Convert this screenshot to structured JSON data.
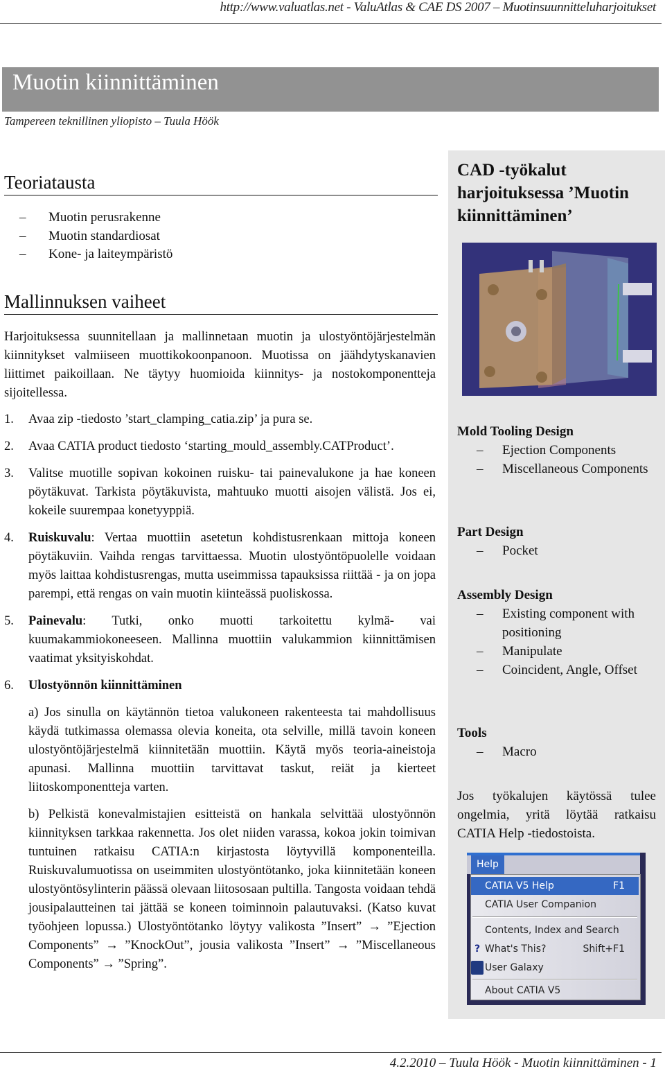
{
  "header": {
    "running_title": "http://www.valuatlas.net - ValuAtlas & CAE DS 2007 – Muotinsuunnitteluharjoitukset"
  },
  "title": {
    "main": "Muotin kiinnittäminen",
    "subtitle": "Tampereen teknillinen yliopisto – Tuula Höök"
  },
  "theory": {
    "heading": "Teoriatausta",
    "items": [
      "Muotin perusrakenne",
      "Muotin standardiosat",
      "Kone- ja laiteympäristö"
    ]
  },
  "phases": {
    "heading": "Mallinnuksen vaiheet",
    "intro": "Harjoituksessa suunnitellaan ja mallinnetaan muotin ja ulostyöntöjärjestelmän kiinnitykset valmiiseen muottikokoonpanoon. Muotissa on jäähdytyskanavien liittimet paikoillaan. Ne täytyy huomioida kiinnitys- ja nostokomponentteja sijoitellessa.",
    "steps": [
      {
        "num": "1.",
        "bold": "",
        "text": "Avaa zip -tiedosto ’start_clamping_catia.zip’ ja pura se."
      },
      {
        "num": "2.",
        "bold": "",
        "text": "Avaa CATIA product tiedosto ‘starting_mould_assembly.CATProduct’."
      },
      {
        "num": "3.",
        "bold": "",
        "text": "Valitse muotille sopivan kokoinen ruisku- tai painevalukone ja hae koneen pöytäkuvat. Tarkista pöytäkuvista, mahtuuko muotti aisojen välistä. Jos ei, kokeile suurempaa konetyyppiä."
      },
      {
        "num": "4.",
        "bold": "Ruiskuvalu",
        "text": ": Vertaa muottiin asetetun kohdistusrenkaan mittoja koneen pöytäkuviin. Vaihda rengas tarvittaessa. Muotin ulostyöntöpuolelle voidaan myös laittaa kohdistusrengas, mutta useimmissa tapauksissa riittää - ja on jopa parempi, että rengas on vain muotin kiinteässä puoliskossa."
      },
      {
        "num": "5.",
        "bold": "Painevalu",
        "text": ": Tutki, onko muotti tarkoitettu kylmä- vai kuumakammiokoneeseen. Mallinna muottiin valukammion kiinnittämisen vaatimat yksityiskohdat."
      },
      {
        "num": "6.",
        "bold": "Ulostyönnön kiinnittäminen",
        "text": "",
        "sub_a": "a) Jos sinulla on käytännön tietoa valukoneen rakenteesta tai mahdollisuus käydä tutkimassa olemassa olevia koneita, ota selville, millä tavoin koneen ulostyöntöjärjestelmä kiinnitetään muottiin. Käytä myös teoria-aineistoja apunasi. Mallinna muottiin tarvittavat taskut, reiät ja kierteet liitoskomponentteja varten.",
        "sub_b": "b) Pelkistä konevalmistajien esitteistä on hankala selvittää ulostyönnön kiinnityksen tarkkaa rakennetta. Jos olet niiden varassa, kokoa jokin toimivan tuntuinen ratkaisu CATIA:n kirjastosta löytyvillä komponenteilla. Ruiskuvalumuotissa on useimmiten ulostyöntötanko, joka kiinnitetään koneen ulostyöntösylinterin päässä olevaan liitososaan pultilla. Tangosta voidaan tehdä jousipalautteinen tai jättää se koneen toiminnoin palautuvaksi. (Katso kuvat työohjeen lopussa.) Ulostyöntötanko löytyy valikosta ”Insert” → ”Ejection Components” → ”KnockOut”, jousia valikosta ”Insert” → ”Miscellaneous Components” → ”Spring”."
      }
    ]
  },
  "sidebar": {
    "heading": "CAD -työkalut harjoituksessa ’Muotin kiinnittäminen’",
    "image_alt": "CATIA mould assembly render",
    "groups": [
      {
        "title": "Mold Tooling Design",
        "items": [
          "Ejection Components",
          "Miscellaneous Components"
        ]
      },
      {
        "title": "Part Design",
        "items": [
          "Pocket"
        ]
      },
      {
        "title": "Assembly Design",
        "items": [
          "Existing component with positioning",
          "Manipulate",
          "Coincident, Angle, Offset"
        ]
      },
      {
        "title": "Tools",
        "items": [
          "Macro"
        ]
      }
    ],
    "note": "Jos työkalujen käytössä tulee ongelmia, yritä löytää ratkaisu CATIA Help -tiedostoista.",
    "help_menu": {
      "menu_title": "Help",
      "items": [
        {
          "label": "CATIA V5 Help",
          "shortcut": "F1",
          "selected": true
        },
        {
          "label": "CATIA User Companion",
          "shortcut": ""
        },
        {
          "label": "Contents, Index and Search",
          "shortcut": ""
        },
        {
          "label": "What's This?",
          "shortcut": "Shift+F1",
          "icon": "whats-this-icon"
        },
        {
          "label": "User Galaxy",
          "shortcut": "",
          "icon": "user-galaxy-icon"
        },
        {
          "label": "About CATIA V5",
          "shortcut": ""
        }
      ]
    }
  },
  "footer": {
    "text": "4.2.2010 – Tuula Höök - Muotin kiinnittäminen - 1"
  },
  "colors": {
    "title_bar": "#929292",
    "sidebar_bg": "#e6e6e6",
    "image_bg": "#33327a",
    "menu_highlight": "#3568c2"
  }
}
